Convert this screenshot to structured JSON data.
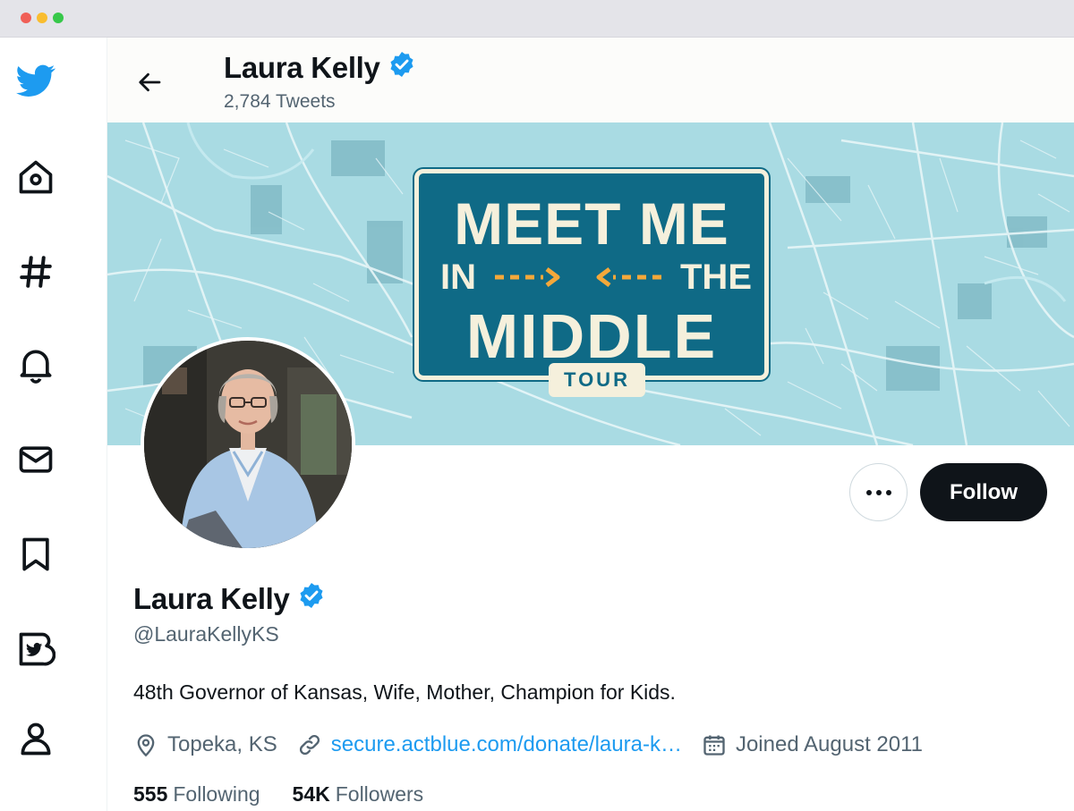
{
  "colors": {
    "brand": "#1d9bf0",
    "verified": "#1d9bf0",
    "follow_bg": "#0f1419",
    "banner_bg": "#a9dbe3",
    "sign_bg": "#0f6a86",
    "sign_text": "#f5f0dc",
    "arrow": "#f4a83a"
  },
  "sidebar": {
    "items": [
      {
        "icon": "twitter-logo-icon"
      },
      {
        "icon": "home-icon"
      },
      {
        "icon": "hashtag-icon"
      },
      {
        "icon": "bell-icon"
      },
      {
        "icon": "envelope-icon"
      },
      {
        "icon": "bookmark-icon"
      },
      {
        "icon": "twitter-blue-icon"
      },
      {
        "icon": "profile-icon"
      }
    ]
  },
  "header": {
    "name": "Laura Kelly",
    "tweet_count": "2,784 Tweets"
  },
  "banner": {
    "line1": "MEET ME",
    "line2_left": "IN",
    "line2_right": "THE",
    "line3": "MIDDLE",
    "tag": "TOUR"
  },
  "actions": {
    "follow_label": "Follow"
  },
  "profile": {
    "name": "Laura Kelly",
    "handle": "@LauraKellyKS",
    "bio": "48th Governor of Kansas, Wife, Mother, Champion for Kids.",
    "location": "Topeka, KS",
    "link": "secure.actblue.com/donate/laura-k…",
    "joined": "Joined August 2011",
    "following_count": "555",
    "following_label": "Following",
    "followers_count": "54K",
    "followers_label": "Followers"
  }
}
